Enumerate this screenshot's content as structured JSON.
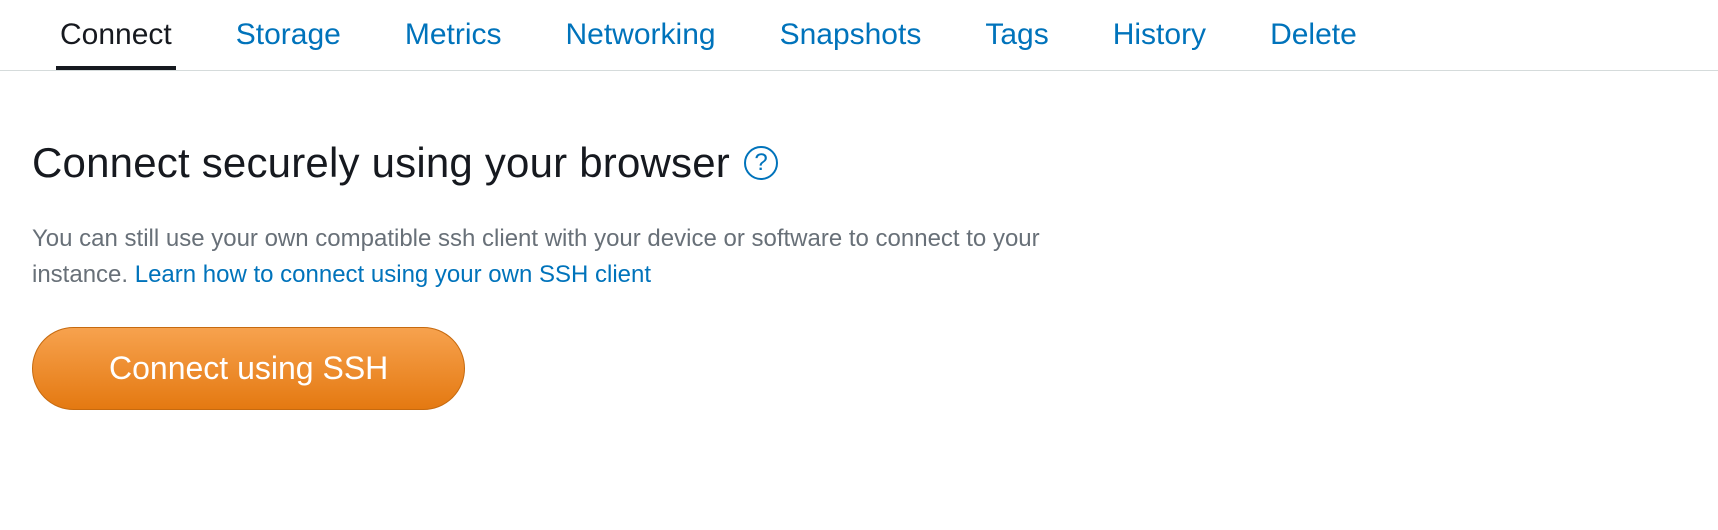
{
  "tabs": {
    "items": [
      {
        "label": "Connect",
        "active": true
      },
      {
        "label": "Storage",
        "active": false
      },
      {
        "label": "Metrics",
        "active": false
      },
      {
        "label": "Networking",
        "active": false
      },
      {
        "label": "Snapshots",
        "active": false
      },
      {
        "label": "Tags",
        "active": false
      },
      {
        "label": "History",
        "active": false
      },
      {
        "label": "Delete",
        "active": false
      }
    ]
  },
  "main": {
    "heading": "Connect securely using your browser",
    "help_symbol": "?",
    "description_prefix": "You can still use your own compatible ssh client with your device or software to connect to your instance. ",
    "description_link": "Learn how to connect using your own SSH client",
    "button_label": "Connect using SSH"
  },
  "colors": {
    "link": "#0073bb",
    "text_primary": "#16191f",
    "text_secondary": "#687078",
    "button_bg_top": "#f7a24e",
    "button_bg_bottom": "#e47911"
  }
}
